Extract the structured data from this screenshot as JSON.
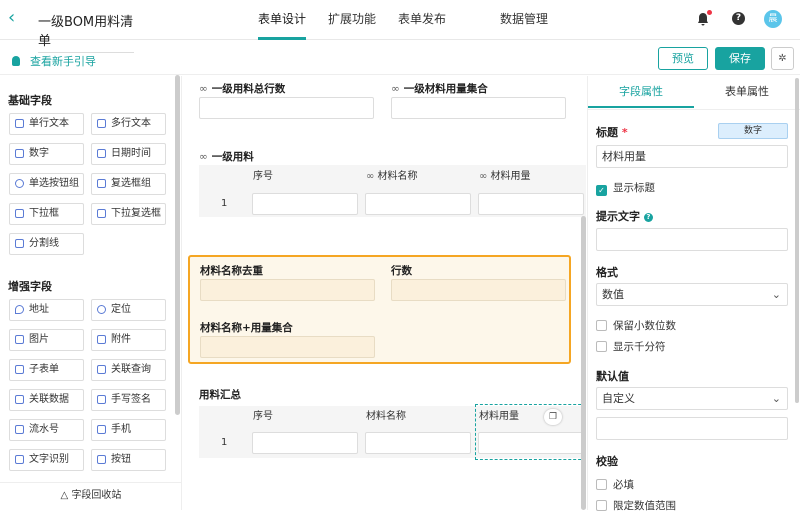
{
  "app": {
    "title": "一级BOM用料清单"
  },
  "tabs": [
    "表单设计",
    "扩展功能",
    "表单发布",
    "数据管理"
  ],
  "header": {
    "avatar": "晨"
  },
  "toolbar": {
    "guide": "查看新手引导",
    "preview": "预览",
    "save": "保存"
  },
  "left": {
    "basic_title": "基础字段",
    "basic": [
      "单行文本",
      "多行文本",
      "数字",
      "日期时间",
      "单选按钮组",
      "复选框组",
      "下拉框",
      "下拉复选框",
      "分割线"
    ],
    "adv_title": "增强字段",
    "adv": [
      "地址",
      "定位",
      "图片",
      "附件",
      "子表单",
      "关联查询",
      "关联数据",
      "手写签名",
      "流水号",
      "手机",
      "文字识别",
      "按钮"
    ],
    "recycle": "字段回收站"
  },
  "canvas": {
    "f1": "一级用料总行数",
    "f2": "一级材料用量集合",
    "sub1": {
      "title": "一级用料",
      "cols": [
        "序号",
        "材料名称",
        "材料用量"
      ],
      "row": "1"
    },
    "hl1": "材料名称去重",
    "hl2": "行数",
    "hl3": "材料名称+用量集合",
    "sub2": {
      "title": "用料汇总",
      "cols": [
        "序号",
        "材料名称",
        "材料用量"
      ],
      "row": "1"
    }
  },
  "right": {
    "tab_field": "字段属性",
    "tab_form": "表单属性",
    "title_label": "标题",
    "required_mark": "*",
    "type_badge": "数字",
    "title_value": "材料用量",
    "show_title": "显示标题",
    "hint_label": "提示文字",
    "format_label": "格式",
    "format_value": "数值",
    "keep_decimal": "保留小数位数",
    "thousands": "显示千分符",
    "default_label": "默认值",
    "default_value": "自定义",
    "verify_label": "校验",
    "required": "必填",
    "range": "限定数值范围"
  }
}
